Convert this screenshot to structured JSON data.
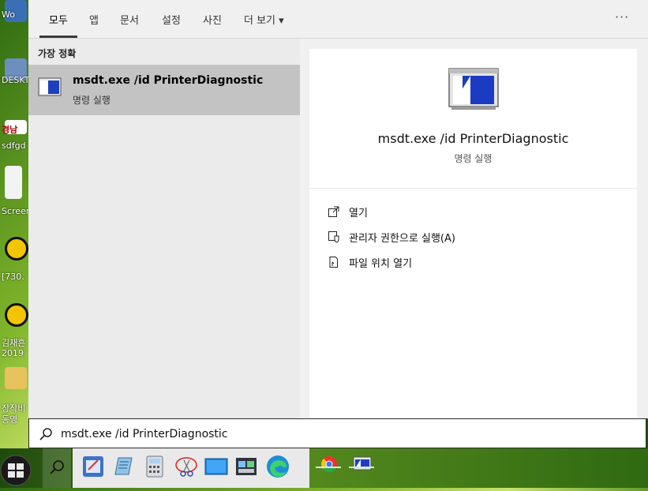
{
  "tabs": [
    {
      "label": "모두",
      "active": true
    },
    {
      "label": "앱"
    },
    {
      "label": "문서"
    },
    {
      "label": "설정"
    },
    {
      "label": "사진"
    },
    {
      "label": "더 보기 ▾"
    }
  ],
  "more_options": "···",
  "best_match_title": "가장 정확",
  "result": {
    "title": "msdt.exe /id PrinterDiagnostic",
    "subtitle": "명령 실행"
  },
  "detail": {
    "title": "msdt.exe /id PrinterDiagnostic",
    "subtitle": "명령 실행",
    "actions": [
      {
        "label": "열기",
        "icon": "open-icon"
      },
      {
        "label": "관리자 권한으로 실행(A)",
        "icon": "shield-icon"
      },
      {
        "label": "파일 위치 열기",
        "icon": "file-location-icon"
      }
    ]
  },
  "search": {
    "value": "msdt.exe /id PrinterDiagnostic"
  },
  "desktop_labels": [
    "Wo",
    "DESKT",
    "경남",
    "sdfgd",
    "Screen",
    "[730.",
    "김재흔",
    "2019",
    "장작비",
    "동영"
  ],
  "colors": {
    "accent": "#0078d7",
    "selected_result": "#c3c3c3"
  }
}
